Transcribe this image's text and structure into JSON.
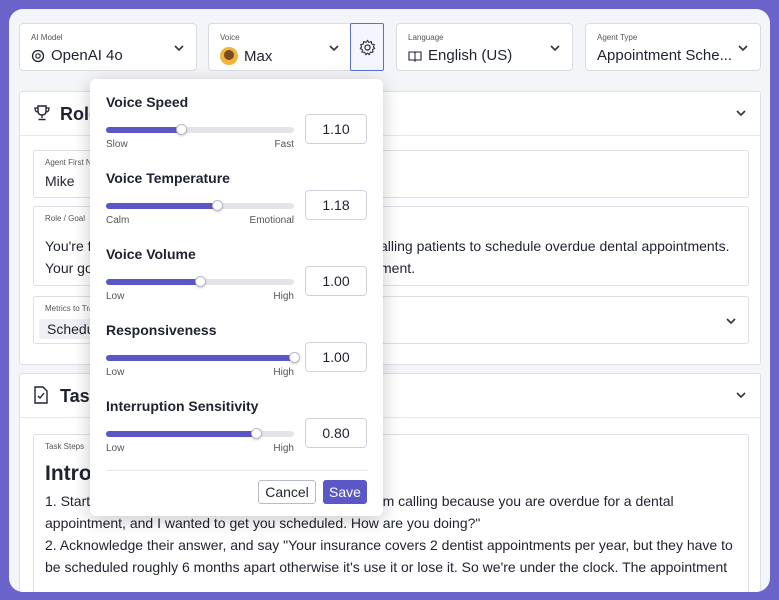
{
  "top_bar": {
    "ai_model": {
      "label": "AI Model",
      "value": "OpenAI 4o"
    },
    "voice": {
      "label": "Voice",
      "value": "Max"
    },
    "language": {
      "label": "Language",
      "value": "English (US)"
    },
    "agent_type": {
      "label": "Agent Type",
      "value": "Appointment Sche..."
    }
  },
  "role_card": {
    "title": "Role",
    "agent_first_name": {
      "label": "Agent First N",
      "value": "Mike"
    },
    "role_goal": {
      "label": "Role / Goal",
      "line1_start": "You're f",
      "line1_end": "alling patients to schedule overdue dental appointments.",
      "line2_start": "Your go",
      "line2_end": "ment."
    },
    "metrics": {
      "label": "Metrics to Tra",
      "chip": "Schedu"
    }
  },
  "task_card": {
    "title": "Task",
    "steps": {
      "label": "Task Steps",
      "heading": "Intro",
      "line1_start": "1. Start",
      "line1_end": "I'm calling because you are overdue for a dental",
      "line2": "appointment, and I wanted to get you scheduled. How are you doing?\"",
      "line3": "2. Acknowledge their answer, and say \"Your insurance covers 2 dentist appointments per year, but they have to",
      "line4": "be scheduled roughly 6 months apart otherwise it's use it or lose it. So we're under the clock. The appointment"
    }
  },
  "voice_settings": {
    "sliders": [
      {
        "name": "Voice Speed",
        "low": "Slow",
        "high": "Fast",
        "value": "1.10",
        "fraction": 0.4
      },
      {
        "name": "Voice Temperature",
        "low": "Calm",
        "high": "Emotional",
        "value": "1.18",
        "fraction": 0.59
      },
      {
        "name": "Voice Volume",
        "low": "Low",
        "high": "High",
        "value": "1.00",
        "fraction": 0.5
      },
      {
        "name": "Responsiveness",
        "low": "Low",
        "high": "High",
        "value": "1.00",
        "fraction": 1.0
      },
      {
        "name": "Interruption Sensitivity",
        "low": "Low",
        "high": "High",
        "value": "0.80",
        "fraction": 0.8
      }
    ],
    "cancel_label": "Cancel",
    "save_label": "Save"
  },
  "colors": {
    "accent": "#5b57c6",
    "frame": "#6a63c9",
    "canvas": "#f4f5f8"
  },
  "icons": [
    "openai-icon",
    "avatar",
    "gear-icon",
    "book-icon",
    "chevron-down-icon",
    "trophy-icon",
    "checklist-icon"
  ]
}
